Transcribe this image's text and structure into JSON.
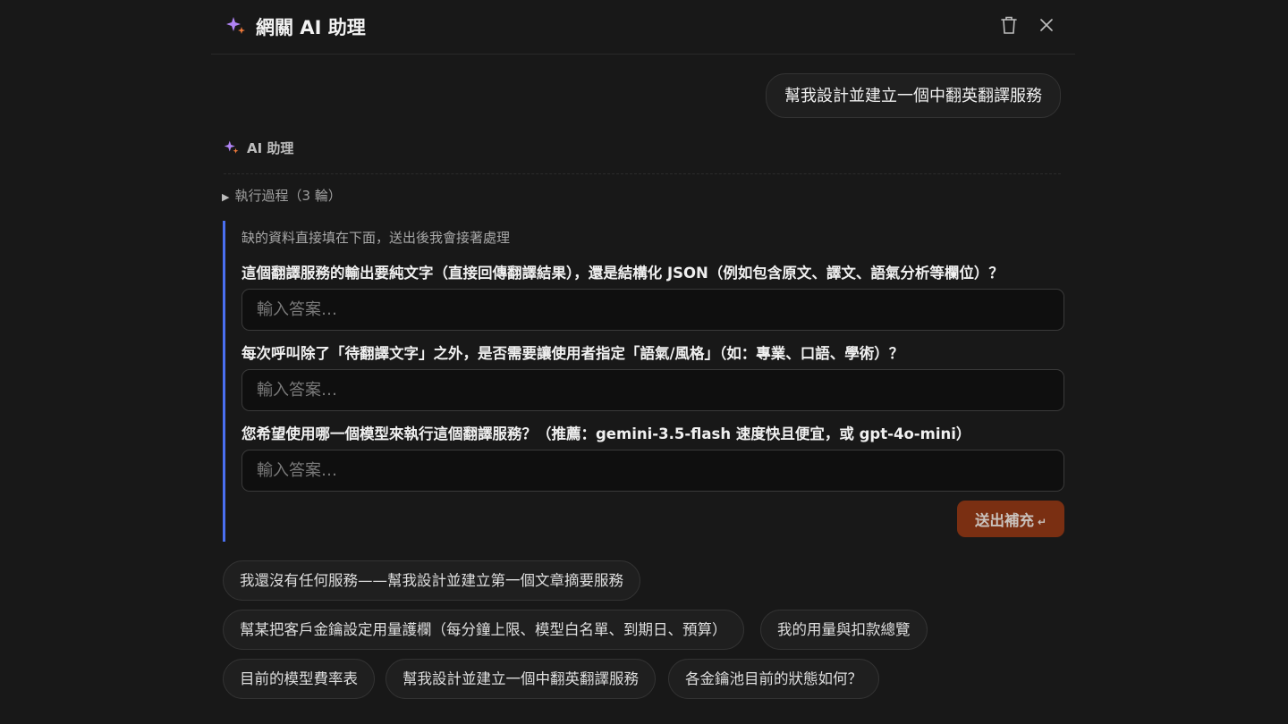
{
  "header": {
    "title": "網關 AI 助理",
    "icons": [
      "sparkle-icon",
      "trash-icon",
      "close-icon"
    ]
  },
  "conversation": {
    "user_message": "幫我設計並建立一個中翻英翻譯服務",
    "assistant_label": "AI 助理",
    "steps_toggle": "執行過程（3 輪）"
  },
  "form": {
    "hint": "缺的資料直接填在下面，送出後我會接著處理",
    "questions": [
      {
        "label": "這個翻譯服務的輸出要純文字（直接回傳翻譯結果），還是結構化 JSON（例如包含原文、譯文、語氣分析等欄位）？",
        "value": "",
        "placeholder": "輸入答案…"
      },
      {
        "label": "每次呼叫除了「待翻譯文字」之外，是否需要讓使用者指定「語氣/風格」（如：專業、口語、學術）？",
        "value": "",
        "placeholder": "輸入答案…"
      },
      {
        "label": "您希望使用哪一個模型來執行這個翻譯服務？（推薦：gemini-3.5-flash 速度快且便宜，或 gpt-4o-mini）",
        "value": "",
        "placeholder": "輸入答案…"
      }
    ],
    "submit_label": "送出補充",
    "submit_hint": "↵"
  },
  "suggestions": [
    "我還沒有任何服務——幫我設計並建立第一個文章摘要服務",
    "幫某把客戶金鑰設定用量護欄（每分鐘上限、模型白名單、到期日、預算）",
    "我的用量與扣款總覽",
    "目前的模型費率表",
    "幫我設計並建立一個中翻英翻譯服務",
    "各金鑰池目前的狀態如何？"
  ],
  "colors": {
    "background": "#181818",
    "accent_border": "#4a6ff0",
    "submit_bg": "#7a2f12",
    "sparkle_purple": "#b084f5",
    "sparkle_orange": "#f07a3a"
  }
}
